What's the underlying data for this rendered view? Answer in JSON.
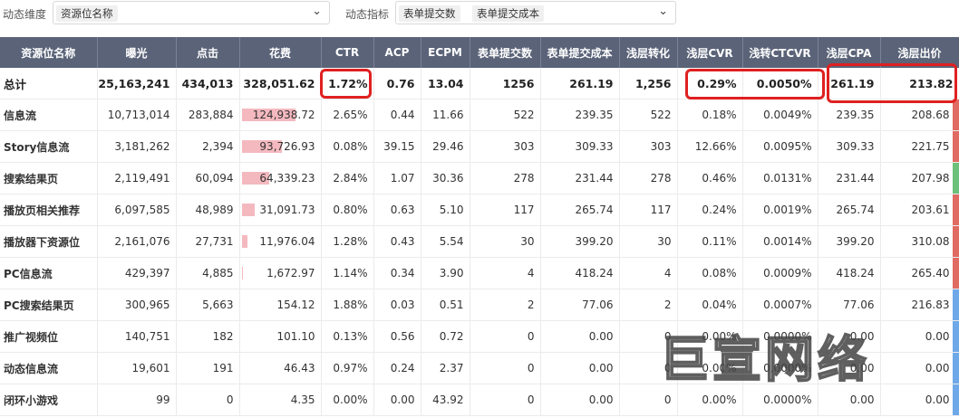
{
  "filters": {
    "dimension_label": "动态维度",
    "dimension_tag": "资源位名称",
    "metric_label": "动态指标",
    "metric_tags": [
      "表单提交数",
      "表单提交成本"
    ]
  },
  "columns": [
    "资源位名称",
    "曝光",
    "点击",
    "花费",
    "CTR",
    "ACP",
    "ECPM",
    "表单提交数",
    "表单提交成本",
    "浅层转化",
    "浅层CVR",
    "浅转CTCVR",
    "浅层CPA",
    "浅层出价"
  ],
  "total": {
    "name": "总计",
    "values": [
      "25,163,241",
      "434,013",
      "328,051.62",
      "1.72%",
      "0.76",
      "13.04",
      "1256",
      "261.19",
      "1,256",
      "0.29%",
      "0.0050%",
      "261.19",
      "213.82"
    ]
  },
  "rows": [
    {
      "name": "信息流",
      "values": [
        "10,713,014",
        "283,884",
        "124,938.72",
        "2.65%",
        "0.44",
        "11.66",
        "522",
        "239.35",
        "522",
        "0.18%",
        "0.0049%",
        "239.35",
        "208.68"
      ],
      "spend_share": 0.7,
      "status_color": "#e06b63"
    },
    {
      "name": "Story信息流",
      "values": [
        "3,181,262",
        "2,394",
        "93,726.93",
        "0.08%",
        "39.15",
        "29.46",
        "303",
        "309.33",
        "303",
        "12.66%",
        "0.0095%",
        "309.33",
        "221.75"
      ],
      "spend_share": 0.52,
      "status_color": "#e06b63"
    },
    {
      "name": "搜索结果页",
      "values": [
        "2,119,491",
        "60,094",
        "64,339.23",
        "2.84%",
        "1.07",
        "30.36",
        "278",
        "231.44",
        "278",
        "0.46%",
        "0.0131%",
        "231.44",
        "207.98"
      ],
      "spend_share": 0.36,
      "status_color": "#6cc07a"
    },
    {
      "name": "播放页相关推荐",
      "values": [
        "6,097,585",
        "48,989",
        "31,091.73",
        "0.80%",
        "0.63",
        "5.10",
        "117",
        "265.74",
        "117",
        "0.24%",
        "0.0019%",
        "265.74",
        "203.61"
      ],
      "spend_share": 0.17,
      "status_color": "#e06b63"
    },
    {
      "name": "播放器下资源位",
      "values": [
        "2,161,076",
        "27,731",
        "11,976.04",
        "1.28%",
        "0.43",
        "5.54",
        "30",
        "399.20",
        "30",
        "0.11%",
        "0.0014%",
        "399.20",
        "310.08"
      ],
      "spend_share": 0.07,
      "status_color": "#e06b63"
    },
    {
      "name": "PC信息流",
      "values": [
        "429,397",
        "4,885",
        "1,672.97",
        "1.14%",
        "0.34",
        "3.90",
        "4",
        "418.24",
        "4",
        "0.08%",
        "0.0009%",
        "418.24",
        "265.40"
      ],
      "spend_share": 0.01,
      "status_color": "#e06b63"
    },
    {
      "name": "PC搜索结果页",
      "values": [
        "300,965",
        "5,663",
        "154.12",
        "1.88%",
        "0.03",
        "0.51",
        "2",
        "77.06",
        "2",
        "0.04%",
        "0.0007%",
        "77.06",
        "216.83"
      ],
      "spend_share": 0.0,
      "status_color": "#6fa8e8"
    },
    {
      "name": "推广视频位",
      "values": [
        "140,751",
        "182",
        "101.10",
        "0.13%",
        "0.56",
        "0.72",
        "0",
        "0.00",
        "0",
        "0.00%",
        "0.0000%",
        "0.00",
        "0.00"
      ],
      "spend_share": 0.0,
      "status_color": "#6fa8e8"
    },
    {
      "name": "动态信息流",
      "values": [
        "19,601",
        "191",
        "46.43",
        "0.97%",
        "0.24",
        "2.37",
        "0",
        "0.00",
        "0",
        "0.00%",
        "0.0000%",
        "0.00",
        "0.00"
      ],
      "spend_share": 0.0,
      "status_color": "#6fa8e8"
    },
    {
      "name": "闭环小游戏",
      "values": [
        "99",
        "0",
        "4.35",
        "0.00%",
        "0.00",
        "43.92",
        "0",
        "0.00",
        "0",
        "0.00%",
        "0.0000%",
        "0.00",
        "0.00"
      ],
      "spend_share": 0.0,
      "status_color": "#6fa8e8"
    }
  ],
  "watermark": "巨宣网络"
}
